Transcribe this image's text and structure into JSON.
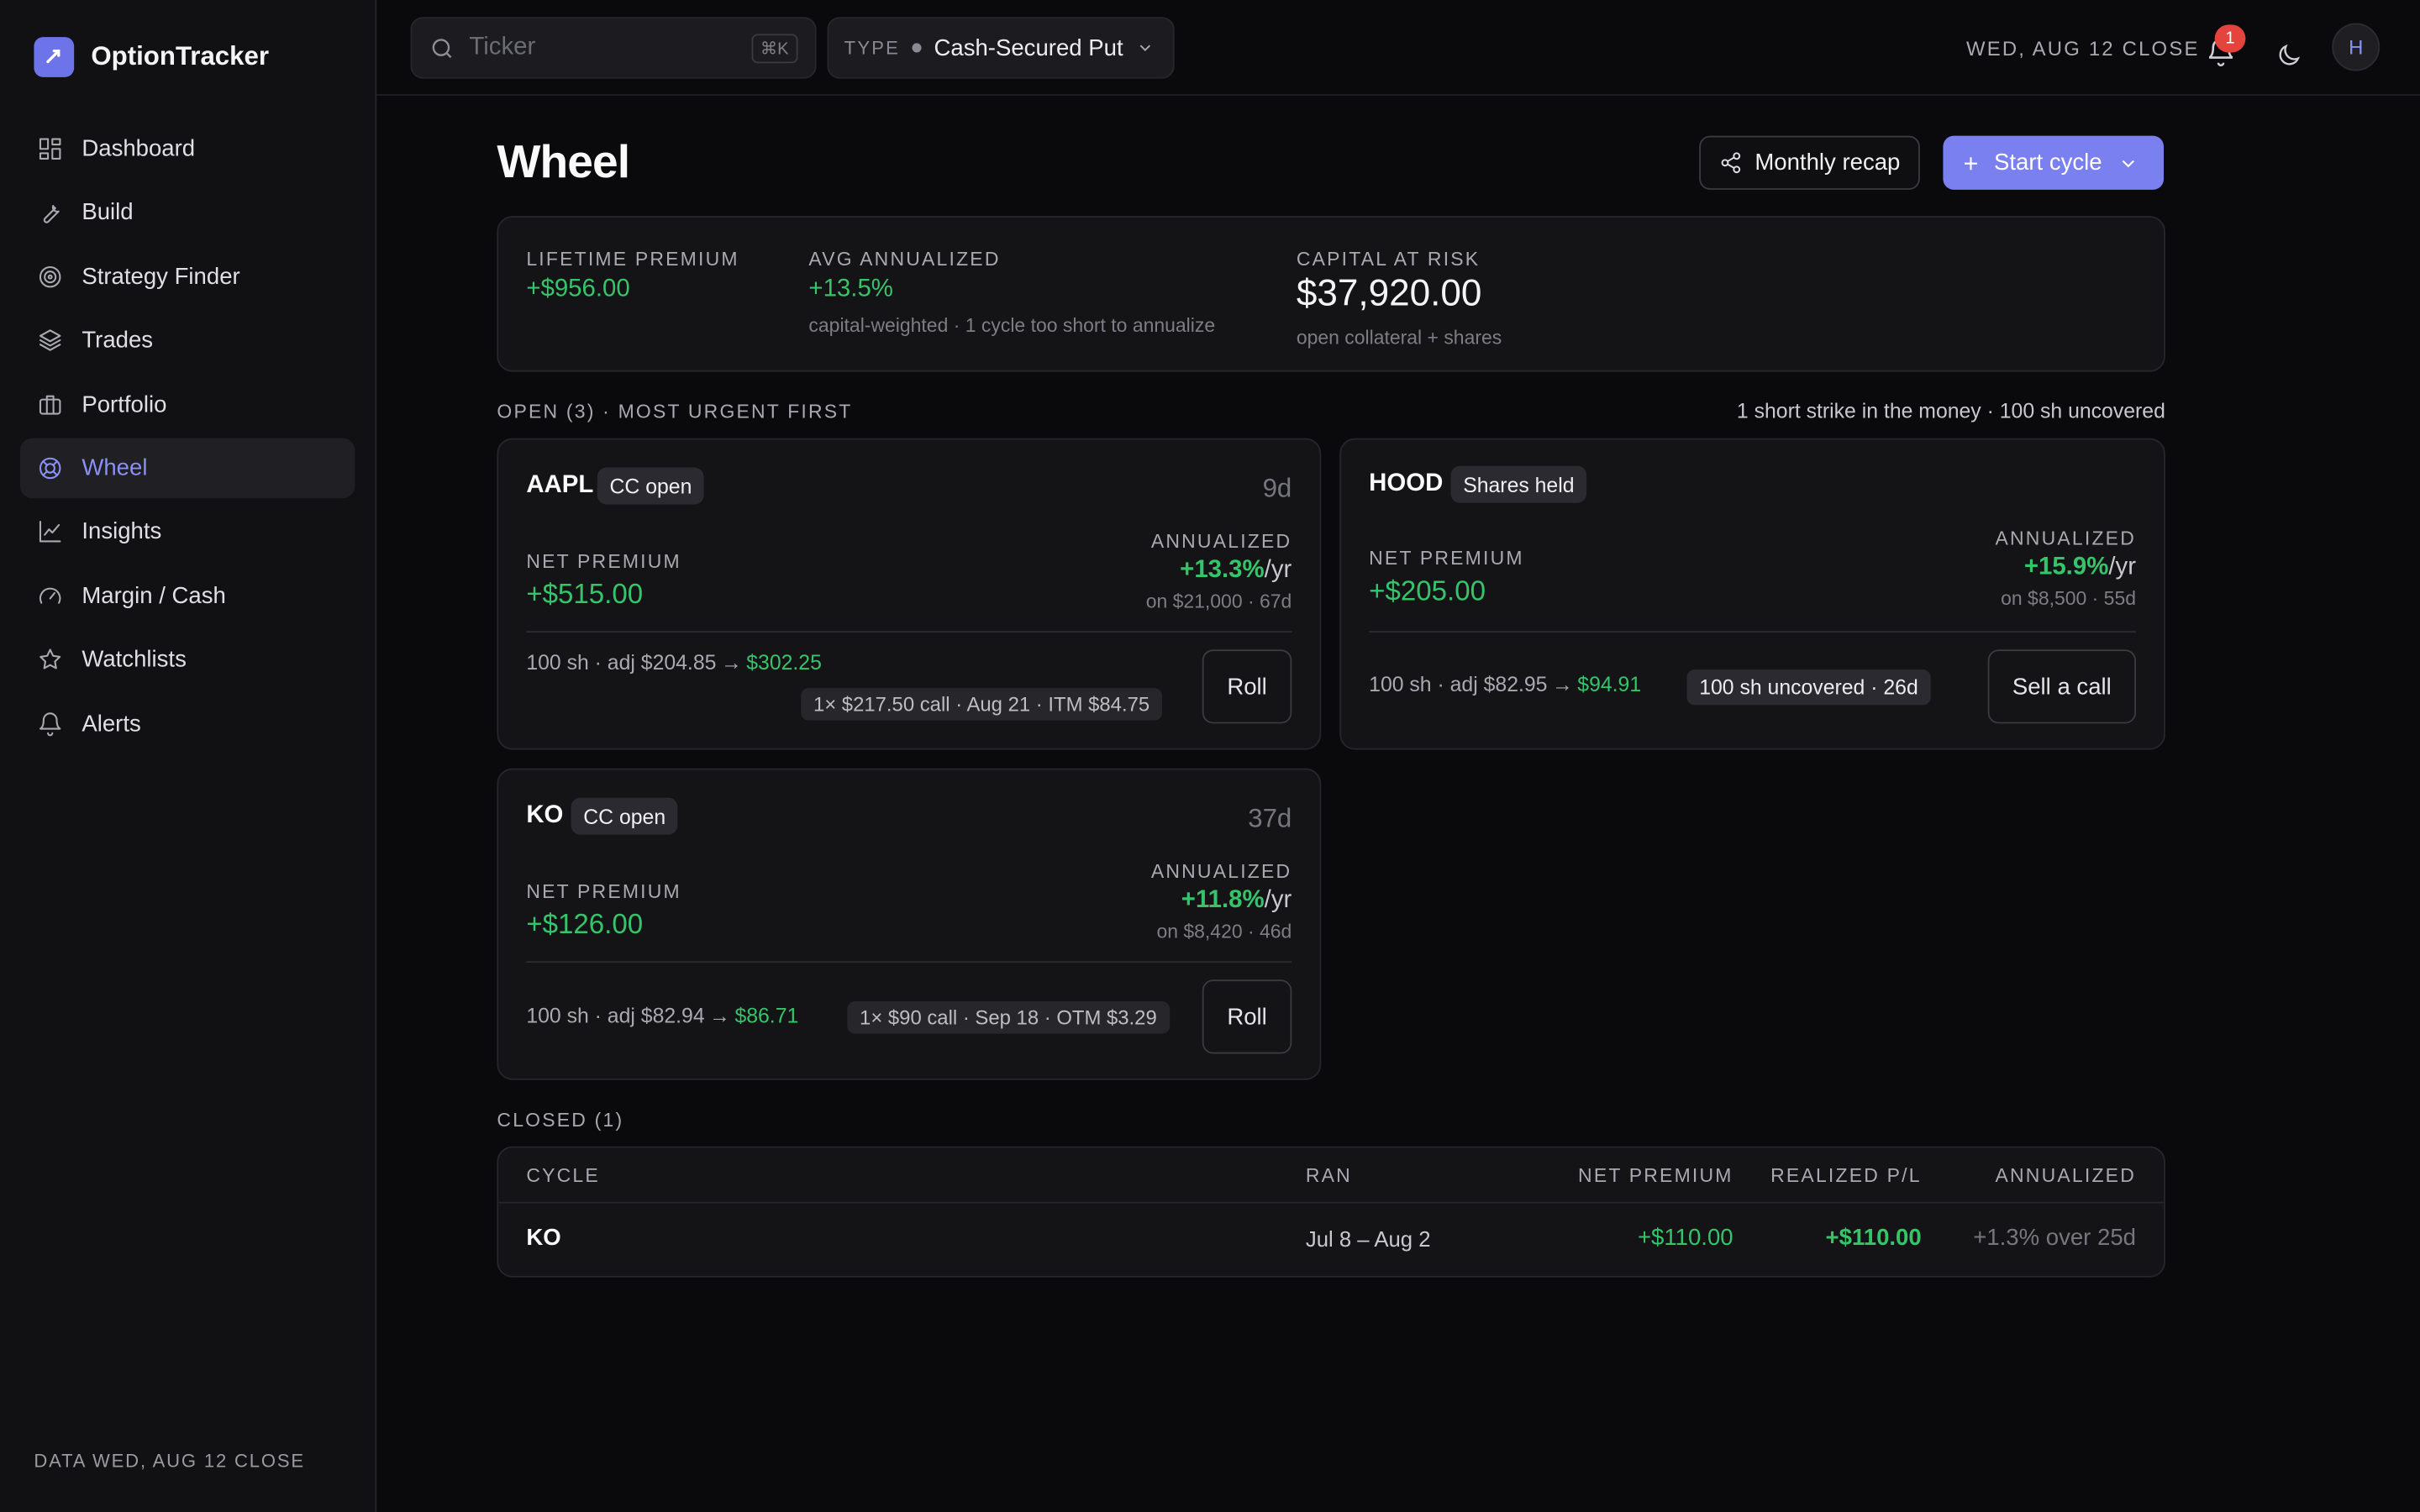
{
  "app": {
    "name": "OptionTracker"
  },
  "sidebar": {
    "items": [
      {
        "label": "Dashboard",
        "icon": "dashboard-icon"
      },
      {
        "label": "Build",
        "icon": "wrench-icon"
      },
      {
        "label": "Strategy Finder",
        "icon": "target-icon"
      },
      {
        "label": "Trades",
        "icon": "layers-icon"
      },
      {
        "label": "Portfolio",
        "icon": "briefcase-icon"
      },
      {
        "label": "Wheel",
        "icon": "lifebuoy-icon",
        "active": true
      },
      {
        "label": "Insights",
        "icon": "chart-line-icon"
      },
      {
        "label": "Margin / Cash",
        "icon": "gauge-icon"
      },
      {
        "label": "Watchlists",
        "icon": "star-icon"
      },
      {
        "label": "Alerts",
        "icon": "bell-icon"
      }
    ],
    "footer": "DATA WED, AUG 12 CLOSE"
  },
  "topbar": {
    "search_placeholder": "Ticker",
    "search_shortcut": "⌘K",
    "type_label": "TYPE",
    "type_value": "Cash-Secured Put",
    "date": "WED, AUG 12 CLOSE",
    "notifications": "1",
    "avatar": "H"
  },
  "page": {
    "title": "Wheel",
    "recap_button": "Monthly recap",
    "start_button": "Start cycle"
  },
  "stats": {
    "lifetime_premium": {
      "label": "LIFETIME PREMIUM",
      "value": "+$956.00"
    },
    "avg_annualized": {
      "label": "AVG ANNUALIZED",
      "value": "+13.5%",
      "sub": "capital-weighted · 1 cycle too short to annualize"
    },
    "capital_at_risk": {
      "label": "CAPITAL AT RISK",
      "value": "$37,920.00",
      "sub": "open collateral + shares"
    }
  },
  "open": {
    "heading": "OPEN (3) · MOST URGENT FIRST",
    "summary": "1 short strike in the money · 100 sh uncovered",
    "cards": [
      {
        "ticker": "AAPL",
        "status": "CC open",
        "dte": "9d",
        "np_label": "NET PREMIUM",
        "np_value": "+$515.00",
        "ann_label": "ANNUALIZED",
        "ann_value": "+13.3%",
        "ann_unit": "/yr",
        "ann_sub": "on $21,000 · 67d",
        "shares": "100 sh · adj $204.85",
        "arrow": "→",
        "price": "$302.25",
        "chip": "1× $217.50 call · Aug 21 · ITM $84.75",
        "action": "Roll"
      },
      {
        "ticker": "HOOD",
        "status": "Shares held",
        "dte": "",
        "np_label": "NET PREMIUM",
        "np_value": "+$205.00",
        "ann_label": "ANNUALIZED",
        "ann_value": "+15.9%",
        "ann_unit": "/yr",
        "ann_sub": "on $8,500 · 55d",
        "shares": "100 sh · adj $82.95",
        "arrow": "→",
        "price": "$94.91",
        "chip": "100 sh uncovered · 26d",
        "action": "Sell a call"
      },
      {
        "ticker": "KO",
        "status": "CC open",
        "dte": "37d",
        "np_label": "NET PREMIUM",
        "np_value": "+$126.00",
        "ann_label": "ANNUALIZED",
        "ann_value": "+11.8%",
        "ann_unit": "/yr",
        "ann_sub": "on $8,420 · 46d",
        "shares": "100 sh · adj $82.94",
        "arrow": "→",
        "price": "$86.71",
        "chip": "1× $90 call · Sep 18 · OTM $3.29",
        "action": "Roll"
      }
    ]
  },
  "closed": {
    "heading": "CLOSED (1)",
    "columns": [
      "CYCLE",
      "RAN",
      "NET PREMIUM",
      "REALIZED P/L",
      "ANNUALIZED"
    ],
    "rows": [
      {
        "cycle": "KO",
        "ran": "Jul 8 – Aug 2",
        "net_premium": "+$110.00",
        "realized": "+$110.00",
        "annualized": "+1.3% over 25d"
      }
    ]
  },
  "colors": {
    "accent": "#7a80f0",
    "positive": "#36c46a",
    "background": "#0a0a0c"
  }
}
